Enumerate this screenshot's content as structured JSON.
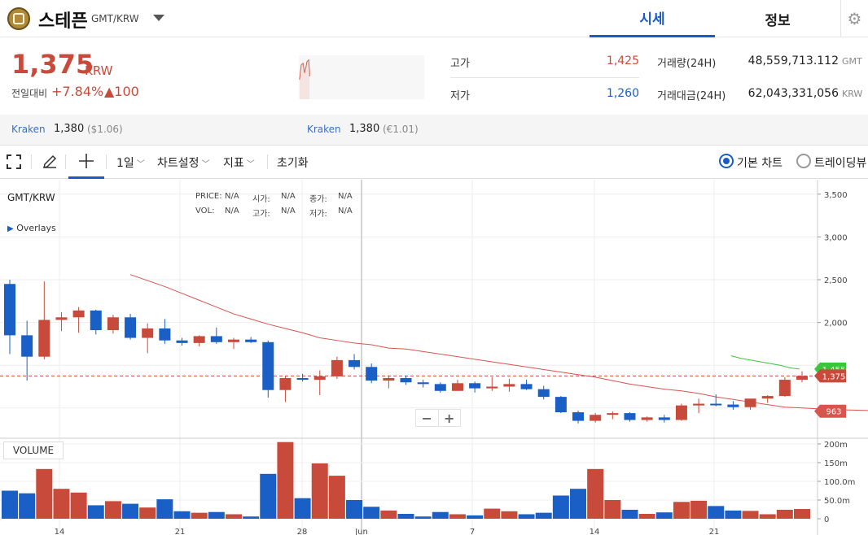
{
  "header": {
    "coin_name": "스테픈",
    "pair": "GMT/KRW",
    "tabs": [
      "시세",
      "정보"
    ]
  },
  "summary": {
    "price": "1,375",
    "unit": "KRW",
    "change_label": "전일대비",
    "change_pct": "+7.84%",
    "change_amt": "▲100",
    "high_label": "고가",
    "high": "1,425",
    "low_label": "저가",
    "low": "1,260",
    "volume_label": "거래량(24H)",
    "volume": "48,559,713.112",
    "volume_unit": "GMT",
    "value_label": "거래대금(24H)",
    "value": "62,043,331,056",
    "value_unit": "KRW"
  },
  "exchanges": [
    {
      "name": "Kraken",
      "price": "1,380",
      "sub": "($1.06)"
    },
    {
      "name": "Kraken",
      "price": "1,380",
      "sub": "(€1.01)"
    }
  ],
  "toolbar": {
    "interval": "1일",
    "chart_settings": "차트설정",
    "indicators": "지표",
    "reset": "초기화",
    "basic_chart": "기본 차트",
    "tradingview": "트레이딩뷰"
  },
  "chart": {
    "pair_label": "GMT/KRW",
    "overlays": "Overlays",
    "volume_label": "VOLUME",
    "ohlc": {
      "price_lbl": "PRICE:",
      "price": "N/A",
      "open_lbl": "시가:",
      "open": "N/A",
      "close_lbl": "종가:",
      "close": "N/A",
      "vol_lbl": "VOL:",
      "vol": "N/A",
      "high_lbl": "고가:",
      "high": "N/A",
      "low_lbl": "저가:",
      "low": "N/A"
    },
    "current_price_tag": "1,375",
    "ma_tag": "963",
    "green_tag": "1,455",
    "up_color": "#c84a3a",
    "down_color": "#1a5fc5"
  },
  "chart_data": {
    "type": "candlestick",
    "pair": "GMT/KRW",
    "y_ticks": [
      3500,
      3000,
      2500,
      2000
    ],
    "vol_ticks": [
      "200m",
      "150m",
      "100.0m",
      "50.0m",
      "0"
    ],
    "x_ticks": [
      "14",
      "21",
      "28",
      "Jun",
      "7",
      "14",
      "21"
    ],
    "candles": [
      {
        "o": 2450,
        "h": 2500,
        "l": 1630,
        "c": 1850,
        "v": 75
      },
      {
        "o": 1850,
        "h": 2020,
        "l": 1320,
        "c": 1600,
        "v": 68
      },
      {
        "o": 1600,
        "h": 2480,
        "l": 1570,
        "c": 2030,
        "v": 133
      },
      {
        "o": 2030,
        "h": 2120,
        "l": 1900,
        "c": 2060,
        "v": 80
      },
      {
        "o": 2060,
        "h": 2180,
        "l": 1880,
        "c": 2140,
        "v": 70
      },
      {
        "o": 2140,
        "h": 2150,
        "l": 1860,
        "c": 1910,
        "v": 36
      },
      {
        "o": 1910,
        "h": 2090,
        "l": 1870,
        "c": 2060,
        "v": 47
      },
      {
        "o": 2060,
        "h": 2100,
        "l": 1800,
        "c": 1820,
        "v": 40
      },
      {
        "o": 1820,
        "h": 1990,
        "l": 1640,
        "c": 1930,
        "v": 30
      },
      {
        "o": 1930,
        "h": 2040,
        "l": 1750,
        "c": 1790,
        "v": 52
      },
      {
        "o": 1790,
        "h": 1820,
        "l": 1730,
        "c": 1760,
        "v": 20
      },
      {
        "o": 1760,
        "h": 1850,
        "l": 1720,
        "c": 1840,
        "v": 16
      },
      {
        "o": 1840,
        "h": 1940,
        "l": 1750,
        "c": 1770,
        "v": 18
      },
      {
        "o": 1770,
        "h": 1820,
        "l": 1690,
        "c": 1800,
        "v": 12
      },
      {
        "o": 1800,
        "h": 1830,
        "l": 1760,
        "c": 1770,
        "v": 6
      },
      {
        "o": 1770,
        "h": 1790,
        "l": 1120,
        "c": 1210,
        "v": 120
      },
      {
        "o": 1210,
        "h": 1370,
        "l": 1070,
        "c": 1350,
        "v": 205
      },
      {
        "o": 1350,
        "h": 1400,
        "l": 1310,
        "c": 1330,
        "v": 55
      },
      {
        "o": 1330,
        "h": 1440,
        "l": 1150,
        "c": 1370,
        "v": 148
      },
      {
        "o": 1370,
        "h": 1600,
        "l": 1340,
        "c": 1560,
        "v": 115
      },
      {
        "o": 1560,
        "h": 1630,
        "l": 1450,
        "c": 1480,
        "v": 50
      },
      {
        "o": 1480,
        "h": 1520,
        "l": 1290,
        "c": 1320,
        "v": 32
      },
      {
        "o": 1320,
        "h": 1380,
        "l": 1230,
        "c": 1350,
        "v": 22
      },
      {
        "o": 1350,
        "h": 1380,
        "l": 1270,
        "c": 1300,
        "v": 13
      },
      {
        "o": 1300,
        "h": 1330,
        "l": 1240,
        "c": 1280,
        "v": 6
      },
      {
        "o": 1280,
        "h": 1300,
        "l": 1180,
        "c": 1200,
        "v": 18
      },
      {
        "o": 1200,
        "h": 1330,
        "l": 1200,
        "c": 1290,
        "v": 12
      },
      {
        "o": 1290,
        "h": 1310,
        "l": 1180,
        "c": 1230,
        "v": 9
      },
      {
        "o": 1230,
        "h": 1360,
        "l": 1200,
        "c": 1250,
        "v": 27
      },
      {
        "o": 1250,
        "h": 1340,
        "l": 1190,
        "c": 1280,
        "v": 20
      },
      {
        "o": 1280,
        "h": 1330,
        "l": 1210,
        "c": 1220,
        "v": 12
      },
      {
        "o": 1220,
        "h": 1260,
        "l": 1100,
        "c": 1130,
        "v": 16
      },
      {
        "o": 1130,
        "h": 1140,
        "l": 940,
        "c": 950,
        "v": 62
      },
      {
        "o": 950,
        "h": 970,
        "l": 820,
        "c": 850,
        "v": 80
      },
      {
        "o": 850,
        "h": 940,
        "l": 830,
        "c": 920,
        "v": 133
      },
      {
        "o": 920,
        "h": 960,
        "l": 870,
        "c": 940,
        "v": 50
      },
      {
        "o": 940,
        "h": 950,
        "l": 840,
        "c": 860,
        "v": 24
      },
      {
        "o": 860,
        "h": 900,
        "l": 840,
        "c": 890,
        "v": 13
      },
      {
        "o": 890,
        "h": 920,
        "l": 830,
        "c": 860,
        "v": 17
      },
      {
        "o": 860,
        "h": 1050,
        "l": 850,
        "c": 1030,
        "v": 45
      },
      {
        "o": 1030,
        "h": 1110,
        "l": 940,
        "c": 1050,
        "v": 48
      },
      {
        "o": 1050,
        "h": 1160,
        "l": 1020,
        "c": 1040,
        "v": 34
      },
      {
        "o": 1040,
        "h": 1080,
        "l": 980,
        "c": 1010,
        "v": 22
      },
      {
        "o": 1010,
        "h": 1100,
        "l": 980,
        "c": 1110,
        "v": 21
      },
      {
        "o": 1110,
        "h": 1150,
        "l": 1060,
        "c": 1140,
        "v": 12
      },
      {
        "o": 1140,
        "h": 1360,
        "l": 1130,
        "c": 1330,
        "v": 24
      },
      {
        "o": 1330,
        "h": 1430,
        "l": 1300,
        "c": 1375,
        "v": 26
      }
    ],
    "ma_series_a": [
      2560,
      2490,
      2420,
      2340,
      2260,
      2180,
      2100,
      2040,
      1980,
      1930,
      1880,
      1820,
      1790,
      1760,
      1740,
      1700,
      1690,
      1660,
      1630,
      1600,
      1570,
      1540,
      1510,
      1480,
      1450,
      1420,
      1390,
      1360,
      1320,
      1280,
      1250,
      1220,
      1200,
      1170,
      1130,
      1100,
      1070,
      1040,
      1010,
      1000,
      990,
      980,
      975,
      970,
      963
    ],
    "ma_series_b": [
      1610,
      1580,
      1560,
      1540,
      1520,
      1500,
      1470,
      1455
    ]
  }
}
